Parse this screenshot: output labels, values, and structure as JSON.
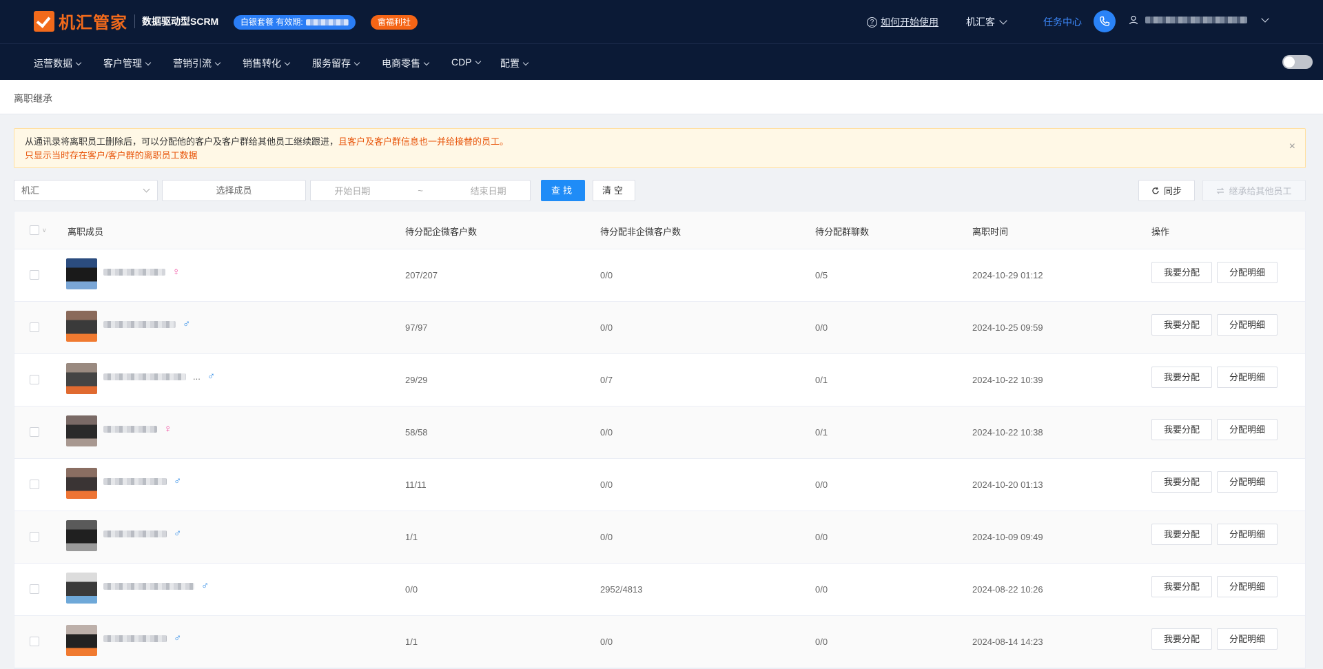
{
  "header": {
    "logo_text": "机汇管家",
    "subtitle": "数据驱动型SCRM",
    "package_badge": "白银套餐 有效期:",
    "welfare_badge": "畲福利社",
    "howto": "如何开始使用",
    "store": "机汇客",
    "tasks": "任务中心",
    "accent_color": "#1f8cf7",
    "brand_color": "#f26a1b"
  },
  "nav": {
    "items": [
      {
        "label": "运营数据"
      },
      {
        "label": "客户管理"
      },
      {
        "label": "营销引流"
      },
      {
        "label": "销售转化"
      },
      {
        "label": "服务留存"
      },
      {
        "label": "电商零售"
      },
      {
        "label": "CDP"
      },
      {
        "label": "配置"
      }
    ]
  },
  "breadcrumb": "离职继承",
  "notice": {
    "line1_normal": "从通讯录将离职员工删除后，可以分配他的客户及客户群给其他员工继续跟进，",
    "line1_warn": "且客户及客户群信息也一并给接替的员工。",
    "line2": "只显示当时存在客户/客户群的离职员工数据"
  },
  "filters": {
    "company": "机汇",
    "member_placeholder": "选择成员",
    "start_date": "开始日期",
    "separator": "~",
    "end_date": "结束日期",
    "search": "查找",
    "clear": "清空",
    "sync": "同步",
    "inherit": "继承给其他员工"
  },
  "table": {
    "columns": [
      "离职成员",
      "待分配企微客户数",
      "待分配非企微客户数",
      "待分配群聊数",
      "离职时间",
      "操作"
    ],
    "action_assign": "我要分配",
    "action_detail": "分配明细",
    "rows": [
      {
        "gender": "♀",
        "gender_type": "f",
        "wecom": "207/207",
        "non_wecom": "0/0",
        "groups": "0/5",
        "time": "2024-10-29 01:12"
      },
      {
        "gender": "♂",
        "gender_type": "m",
        "wecom": "97/97",
        "non_wecom": "0/0",
        "groups": "0/0",
        "time": "2024-10-25 09:59"
      },
      {
        "gender": "♂",
        "gender_type": "m",
        "wecom": "29/29",
        "non_wecom": "0/7",
        "groups": "0/1",
        "time": "2024-10-22 10:39",
        "ellipsis": "..."
      },
      {
        "gender": "♀",
        "gender_type": "f",
        "wecom": "58/58",
        "non_wecom": "0/0",
        "groups": "0/1",
        "time": "2024-10-22 10:38"
      },
      {
        "gender": "♂",
        "gender_type": "m",
        "wecom": "11/11",
        "non_wecom": "0/0",
        "groups": "0/0",
        "time": "2024-10-20 01:13"
      },
      {
        "gender": "♂",
        "gender_type": "m",
        "wecom": "1/1",
        "non_wecom": "0/0",
        "groups": "0/0",
        "time": "2024-10-09 09:49"
      },
      {
        "gender": "♂",
        "gender_type": "m",
        "wecom": "0/0",
        "non_wecom": "2952/4813",
        "groups": "0/0",
        "time": "2024-08-22 10:26"
      },
      {
        "gender": "♂",
        "gender_type": "m",
        "wecom": "1/1",
        "non_wecom": "0/0",
        "groups": "0/0",
        "time": "2024-08-14 14:23"
      }
    ]
  }
}
